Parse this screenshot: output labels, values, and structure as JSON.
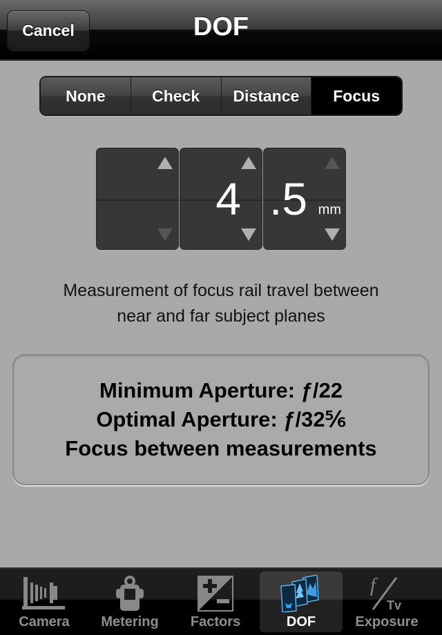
{
  "navbar": {
    "title": "DOF",
    "cancel_label": "Cancel"
  },
  "segmented": {
    "options": [
      "None",
      "Check",
      "Distance",
      "Focus"
    ],
    "selected": "Focus"
  },
  "stepper": {
    "columns": [
      {
        "value": "",
        "up_enabled": true,
        "down_enabled": false
      },
      {
        "value": "4",
        "up_enabled": true,
        "down_enabled": true
      },
      {
        "value": ".5",
        "up_enabled": false,
        "down_enabled": true
      }
    ],
    "unit": "mm",
    "display_value": "4.5"
  },
  "description": {
    "line1": "Measurement of focus rail travel between",
    "line2": "near and far subject planes"
  },
  "result": {
    "line1": "Minimum Aperture: ƒ/22",
    "line2": "Optimal Aperture: ƒ/32⅚",
    "line3": "Focus between measurements"
  },
  "tabbar": {
    "tabs": [
      {
        "label": "Camera",
        "icon": "bellows-camera-icon"
      },
      {
        "label": "Metering",
        "icon": "light-meter-icon"
      },
      {
        "label": "Factors",
        "icon": "exposure-compensation-icon"
      },
      {
        "label": "DOF",
        "icon": "dof-planes-icon"
      },
      {
        "label": "Exposure",
        "icon": "f-tv-icon"
      }
    ],
    "selected": "DOF"
  },
  "colors": {
    "background": "#a9a9a9",
    "active_tab_icon": "#4aa8e8",
    "inactive_tab": "#8e8e8e"
  }
}
